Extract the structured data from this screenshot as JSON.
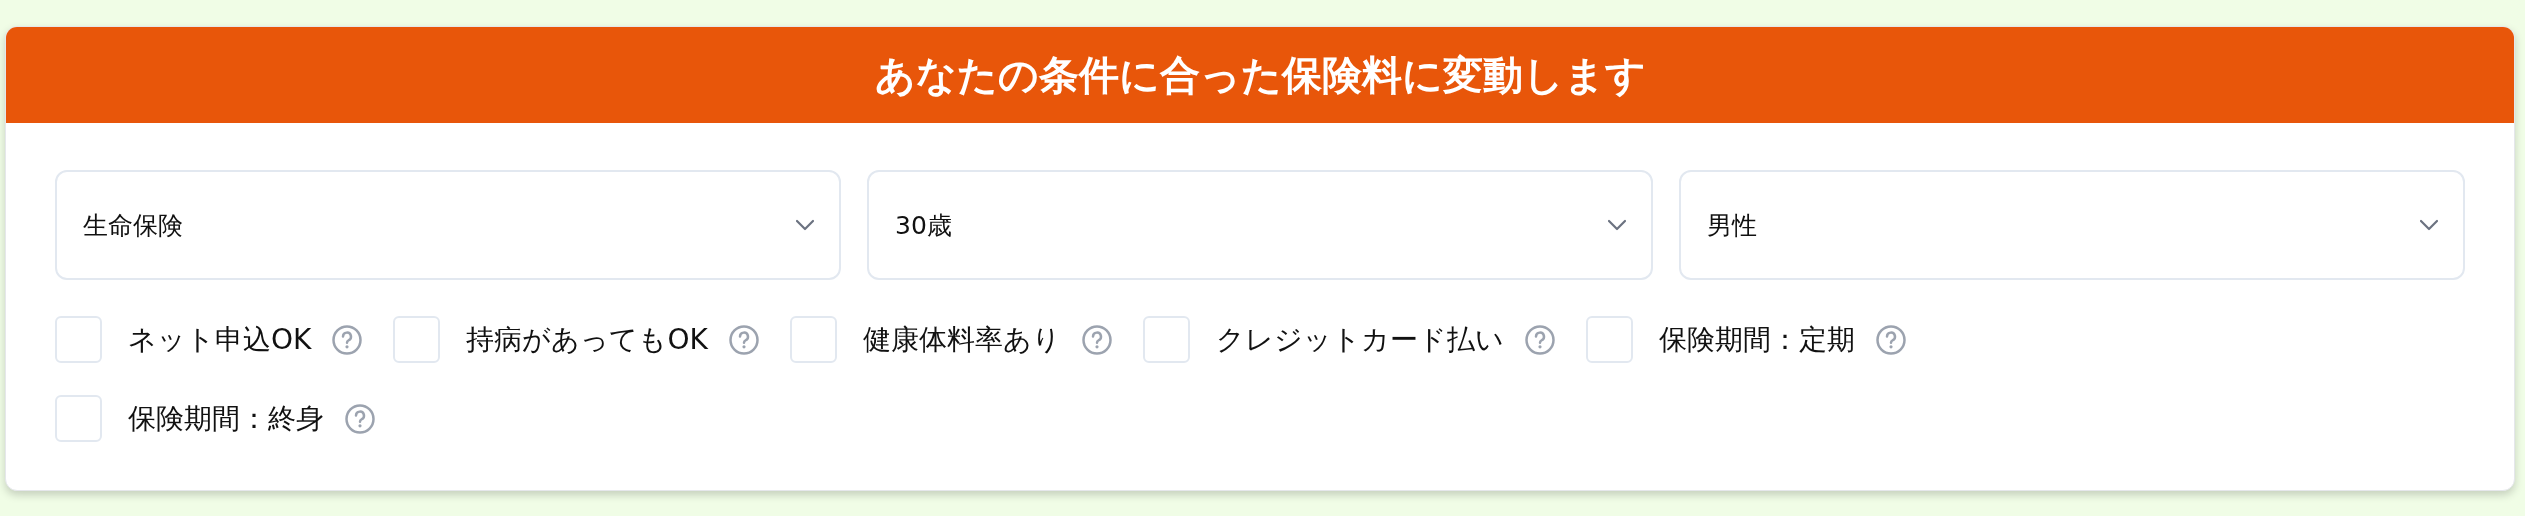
{
  "header": {
    "title": "あなたの条件に合った保険料に変動します"
  },
  "selects": [
    {
      "value": "生命保険"
    },
    {
      "value": "30歳"
    },
    {
      "value": "男性"
    }
  ],
  "options": [
    {
      "label": "ネット申込OK",
      "checked": false
    },
    {
      "label": "持病があってもOK",
      "checked": false
    },
    {
      "label": "健康体料率あり",
      "checked": false
    },
    {
      "label": "クレジットカード払い",
      "checked": false
    },
    {
      "label": "保険期間：定期",
      "checked": false
    },
    {
      "label": "保険期間：終身",
      "checked": false
    }
  ]
}
